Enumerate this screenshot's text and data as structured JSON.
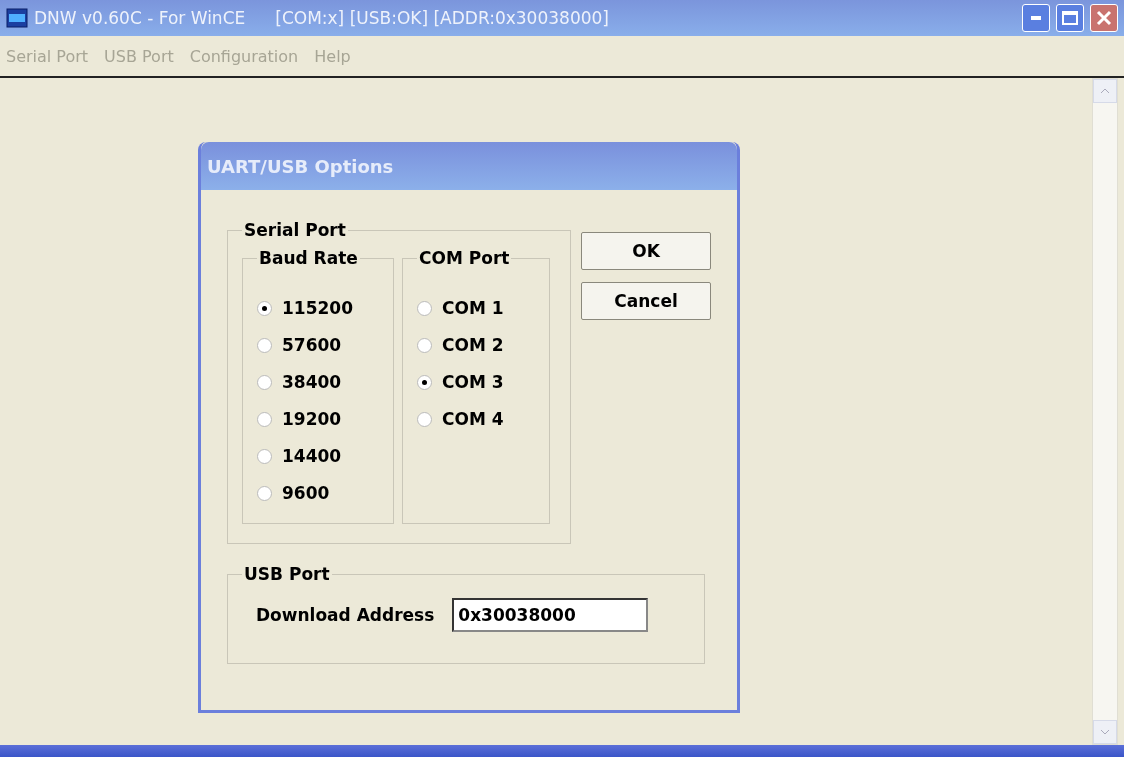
{
  "window": {
    "title": "DNW v0.60C - For WinCE",
    "status": "[COM:x] [USB:OK] [ADDR:0x30038000]"
  },
  "menu": [
    {
      "label": "Serial Port",
      "disabled": true
    },
    {
      "label": "USB Port",
      "disabled": true
    },
    {
      "label": "Configuration",
      "disabled": true
    },
    {
      "label": "Help",
      "disabled": true
    }
  ],
  "dialog": {
    "title": "UART/USB Options",
    "serial_port": {
      "legend": "Serial Port",
      "baud_rate": {
        "legend": "Baud Rate",
        "options": [
          {
            "label": "115200",
            "selected": true
          },
          {
            "label": "57600",
            "selected": false
          },
          {
            "label": "38400",
            "selected": false
          },
          {
            "label": "19200",
            "selected": false
          },
          {
            "label": "14400",
            "selected": false
          },
          {
            "label": "9600",
            "selected": false
          }
        ]
      },
      "com_port": {
        "legend": "COM Port",
        "options": [
          {
            "label": "COM 1",
            "selected": false
          },
          {
            "label": "COM 2",
            "selected": false
          },
          {
            "label": "COM 3",
            "selected": true
          },
          {
            "label": "COM 4",
            "selected": false
          }
        ]
      }
    },
    "buttons": [
      "OK",
      "Cancel"
    ],
    "usb_port": {
      "legend": "USB Port",
      "label": "Download Address",
      "value": "0x30038000"
    }
  }
}
